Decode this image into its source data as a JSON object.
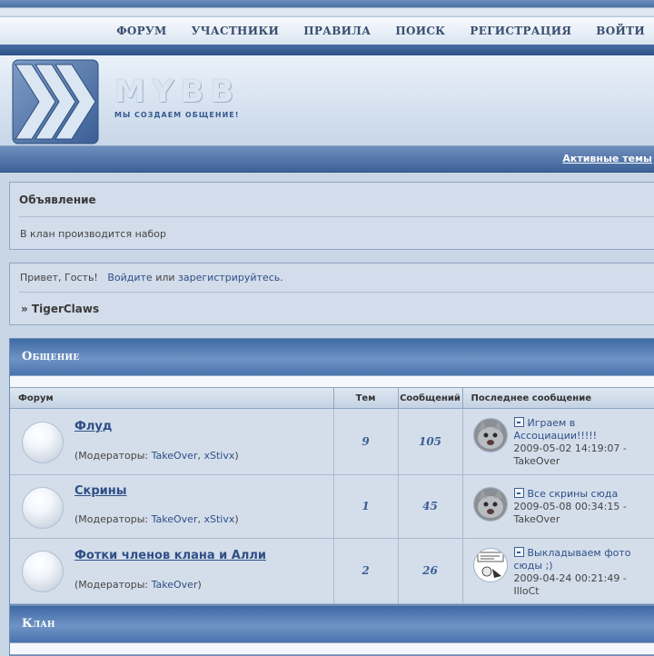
{
  "nav": {
    "items": [
      "ФОРУМ",
      "УЧАСТНИКИ",
      "ПРАВИЛА",
      "ПОИСК",
      "РЕГИСТРАЦИЯ",
      "ВОЙТИ"
    ]
  },
  "header": {
    "logo_text": "MYBB",
    "slogan": "МЫ СОЗДАЕМ ОБЩЕНИЕ!"
  },
  "activebar": {
    "link": "Активные темы"
  },
  "announcement": {
    "title": "Объявление",
    "text": "В клан производится набор"
  },
  "welcome": {
    "greeting": "Привет, Гость!",
    "login_link": "Войдите",
    "or": "или",
    "register_link": "зарегистрируйтесь",
    "period": ".",
    "breadcrumb": "» TigerClaws"
  },
  "categories": [
    {
      "title": "Общение"
    },
    {
      "title": "Клан"
    }
  ],
  "table": {
    "headers": [
      "Форум",
      "Тем",
      "Сообщений",
      "Последнее сообщение"
    ]
  },
  "forums": [
    {
      "name": "Флуд",
      "mods_prefix": "(Модераторы:",
      "mods": [
        "TakeOver",
        "xStivx"
      ],
      "topics": "9",
      "posts": "105",
      "last_title": "Играем в Ассоциации!!!!!",
      "last_date": "2009-05-02 14:19:07 -",
      "last_author": "TakeOver",
      "avatar": "cat-avatar"
    },
    {
      "name": "Скрины",
      "mods_prefix": "(Модераторы:",
      "mods": [
        "TakeOver",
        "xStivx"
      ],
      "topics": "1",
      "posts": "45",
      "last_title": "Все скрины сюда",
      "last_date": "2009-05-08 00:34:15 -",
      "last_author": "TakeOver",
      "avatar": "cat-avatar"
    },
    {
      "name": "Фотки членов клана и Алли",
      "mods_prefix": "(Модераторы:",
      "mods": [
        "TakeOver"
      ],
      "topics": "2",
      "posts": "26",
      "last_title": "Выкладываем фото сюды ;)",
      "last_date": "2009-04-24 00:21:49 -",
      "last_author": "IlloCt",
      "avatar": "comic-avatar"
    }
  ],
  "colors": {
    "accent": "#3f6aa5",
    "link": "#2f4f86",
    "bg": "#c9d6e6"
  }
}
